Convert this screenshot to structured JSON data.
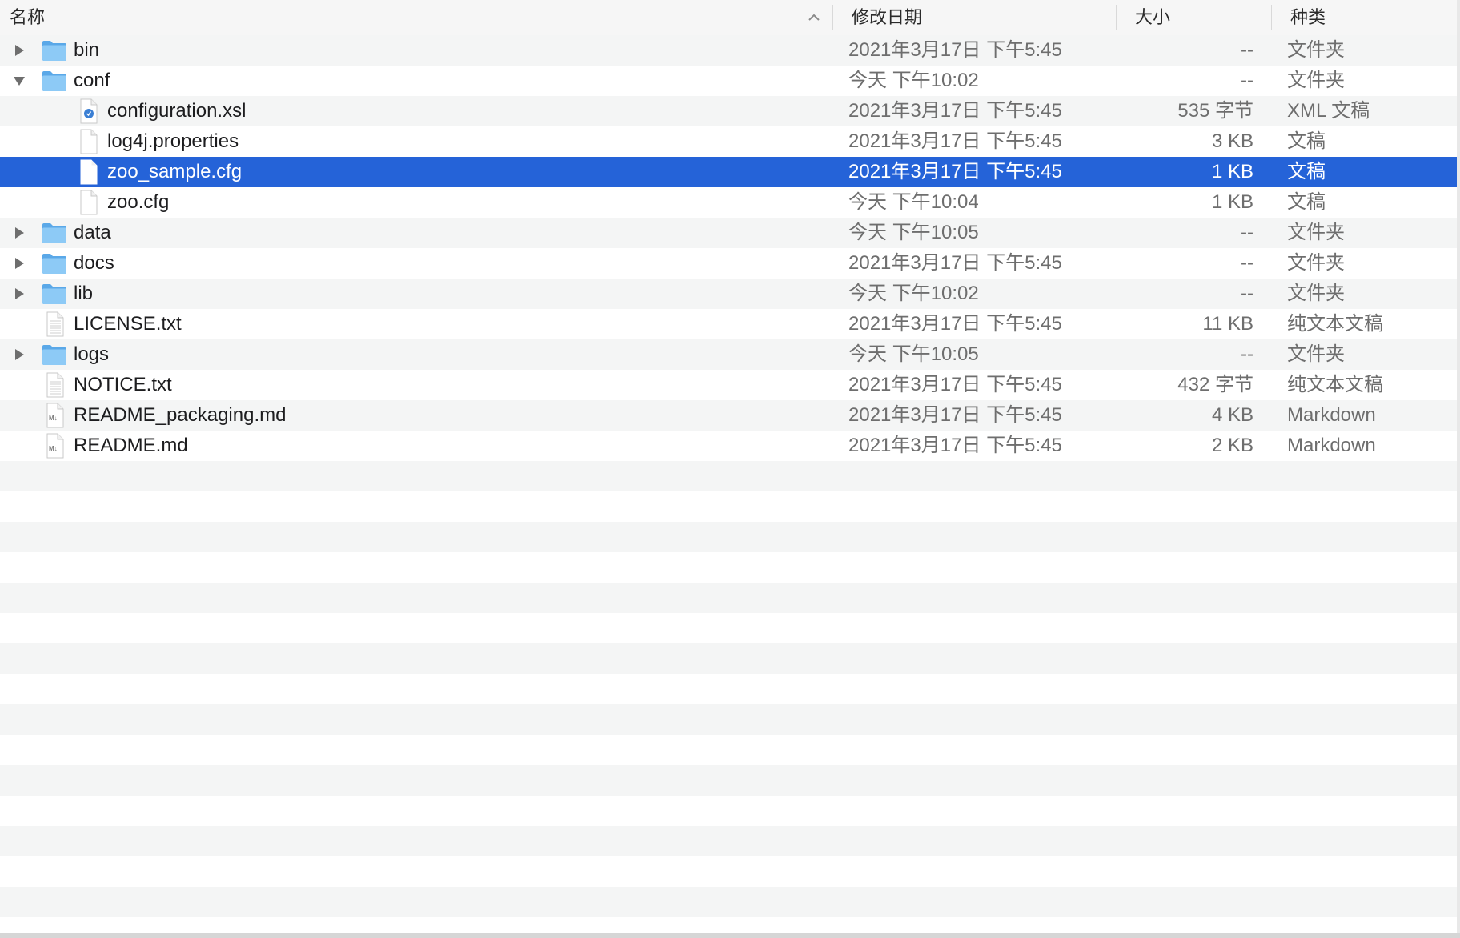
{
  "header": {
    "name": "名称",
    "date": "修改日期",
    "size": "大小",
    "kind": "种类"
  },
  "rows": [
    {
      "name": "bin",
      "date": "2021年3月17日 下午5:45",
      "size": "--",
      "kind": "文件夹",
      "level": 0,
      "type": "folder",
      "disclosure": "collapsed"
    },
    {
      "name": "conf",
      "date": "今天 下午10:02",
      "size": "--",
      "kind": "文件夹",
      "level": 0,
      "type": "folder",
      "disclosure": "expanded"
    },
    {
      "name": "configuration.xsl",
      "date": "2021年3月17日 下午5:45",
      "size": "535 字节",
      "kind": "XML 文稿",
      "level": 1,
      "type": "xml",
      "disclosure": "none"
    },
    {
      "name": "log4j.properties",
      "date": "2021年3月17日 下午5:45",
      "size": "3 KB",
      "kind": "文稿",
      "level": 1,
      "type": "doc",
      "disclosure": "none"
    },
    {
      "name": "zoo_sample.cfg",
      "date": "2021年3月17日 下午5:45",
      "size": "1 KB",
      "kind": "文稿",
      "level": 1,
      "type": "doc",
      "disclosure": "none",
      "selected": true
    },
    {
      "name": "zoo.cfg",
      "date": "今天 下午10:04",
      "size": "1 KB",
      "kind": "文稿",
      "level": 1,
      "type": "doc",
      "disclosure": "none"
    },
    {
      "name": "data",
      "date": "今天 下午10:05",
      "size": "--",
      "kind": "文件夹",
      "level": 0,
      "type": "folder",
      "disclosure": "collapsed"
    },
    {
      "name": "docs",
      "date": "2021年3月17日 下午5:45",
      "size": "--",
      "kind": "文件夹",
      "level": 0,
      "type": "folder",
      "disclosure": "collapsed"
    },
    {
      "name": "lib",
      "date": "今天 下午10:02",
      "size": "--",
      "kind": "文件夹",
      "level": 0,
      "type": "folder",
      "disclosure": "collapsed"
    },
    {
      "name": "LICENSE.txt",
      "date": "2021年3月17日 下午5:45",
      "size": "11 KB",
      "kind": "纯文本文稿",
      "level": 0,
      "type": "text",
      "disclosure": "none"
    },
    {
      "name": "logs",
      "date": "今天 下午10:05",
      "size": "--",
      "kind": "文件夹",
      "level": 0,
      "type": "folder",
      "disclosure": "collapsed"
    },
    {
      "name": "NOTICE.txt",
      "date": "2021年3月17日 下午5:45",
      "size": "432 字节",
      "kind": "纯文本文稿",
      "level": 0,
      "type": "text",
      "disclosure": "none"
    },
    {
      "name": "README_packaging.md",
      "date": "2021年3月17日 下午5:45",
      "size": "4 KB",
      "kind": "Markdown",
      "level": 0,
      "type": "markdown",
      "disclosure": "none"
    },
    {
      "name": "README.md",
      "date": "2021年3月17日 下午5:45",
      "size": "2 KB",
      "kind": "Markdown",
      "level": 0,
      "type": "markdown",
      "disclosure": "none"
    }
  ],
  "colors": {
    "selection": "#2563d8",
    "folder": "#6cb8f2",
    "stripe": "#f4f5f5"
  }
}
